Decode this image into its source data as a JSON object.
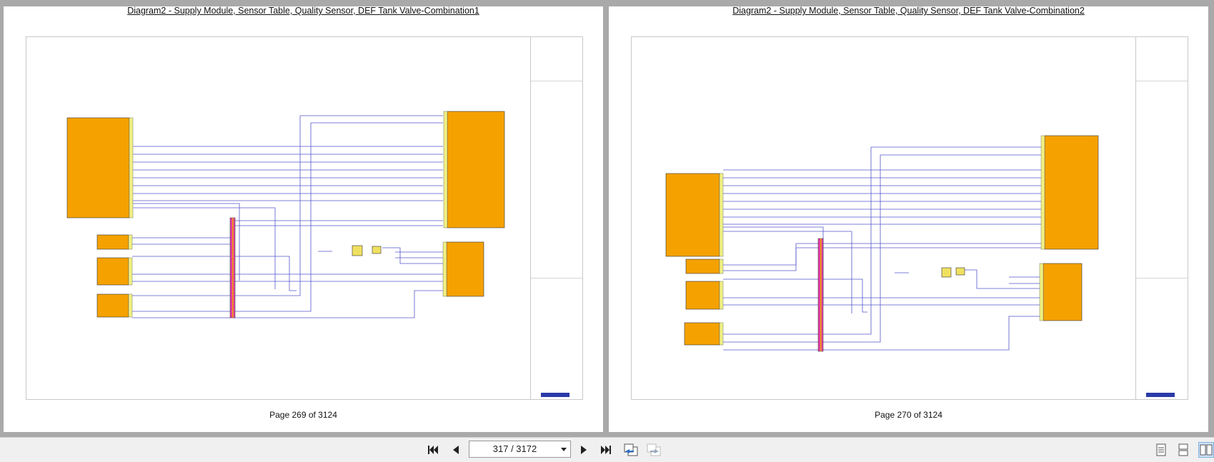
{
  "pages": [
    {
      "title": "Diagram2 - Supply Module, Sensor Table, Quality Sensor, DEF Tank Valve-Combination1",
      "footer": "Page 269 of 3124"
    },
    {
      "title": "Diagram2 - Supply Module, Sensor Table, Quality Sensor, DEF Tank Valve-Combination2",
      "footer": "Page 270 of 3124"
    }
  ],
  "toolbar": {
    "page_indicator": "317 / 3172",
    "icons": [
      "first-page-icon",
      "previous-page-icon",
      "next-page-icon",
      "last-page-icon",
      "back-view-icon",
      "forward-view-icon",
      "single-page-view-icon",
      "continuous-view-icon",
      "two-page-view-icon"
    ]
  },
  "colors": {
    "module_fill": "#f5a200",
    "wire": "#5555cc",
    "connector": "#e040a0",
    "active_view": "#cfe3f7"
  }
}
